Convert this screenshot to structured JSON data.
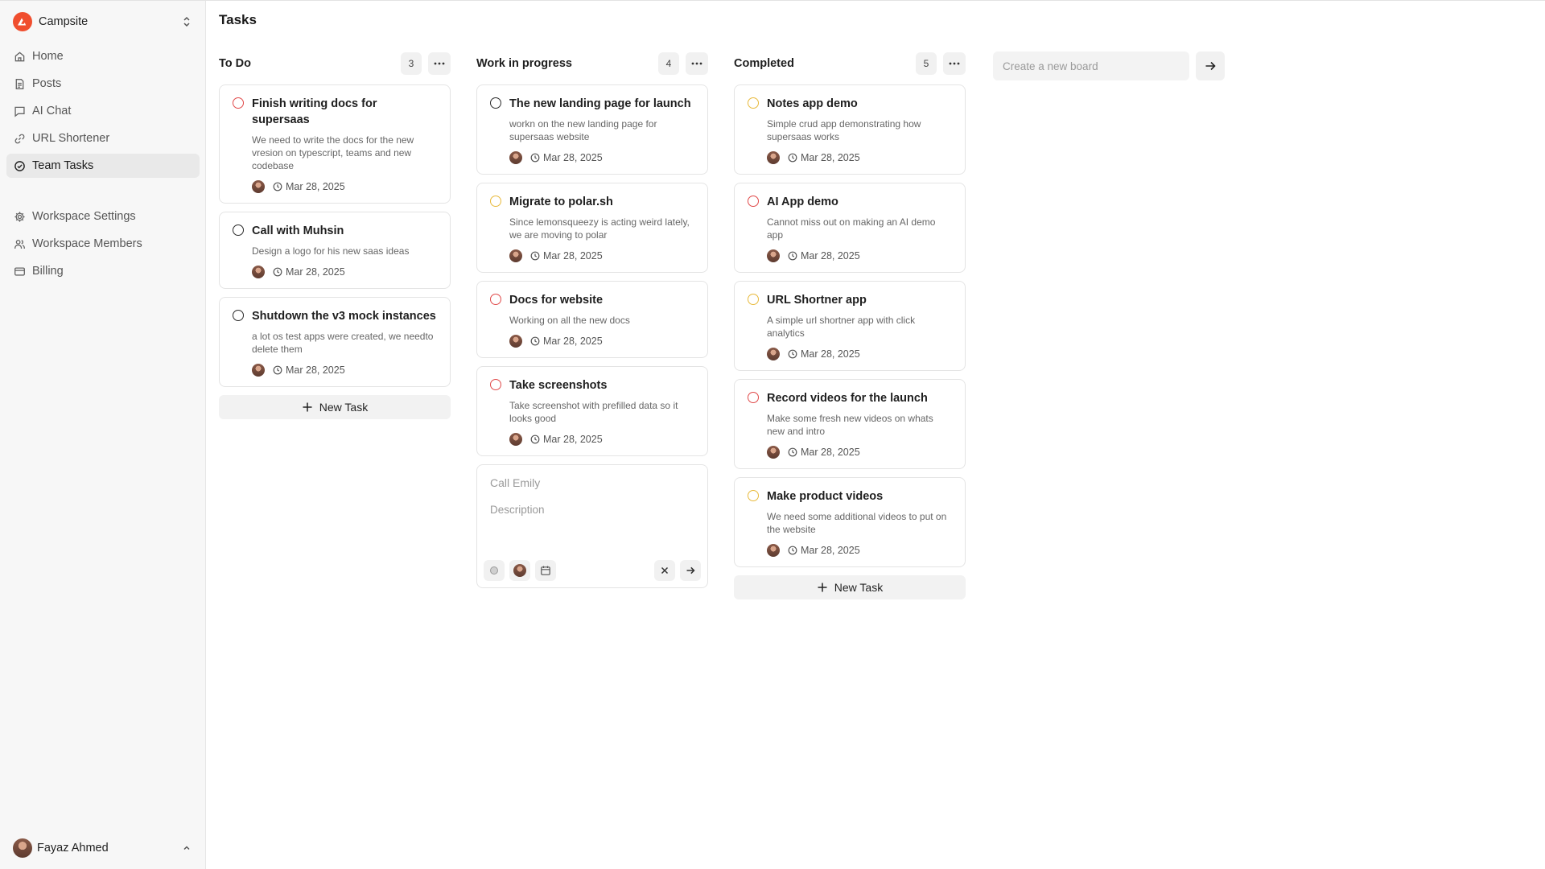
{
  "app": {
    "workspace_name": "Campsite",
    "brand_color": "#f04e2e"
  },
  "sidebar": {
    "nav": [
      {
        "label": "Home",
        "icon": "home-icon"
      },
      {
        "label": "Posts",
        "icon": "document-icon"
      },
      {
        "label": "AI Chat",
        "icon": "chat-icon"
      },
      {
        "label": "URL Shortener",
        "icon": "link-icon"
      },
      {
        "label": "Team Tasks",
        "icon": "check-circle-icon",
        "active": true
      }
    ],
    "settings": [
      {
        "label": "Workspace Settings",
        "icon": "gear-icon"
      },
      {
        "label": "Workspace Members",
        "icon": "users-icon"
      },
      {
        "label": "Billing",
        "icon": "credit-card-icon"
      }
    ],
    "user": {
      "name": "Fayaz Ahmed"
    }
  },
  "page": {
    "title": "Tasks"
  },
  "columns": [
    {
      "title": "To Do",
      "count": "3",
      "cards": [
        {
          "title": "Finish writing docs for supersaas",
          "description": "We need to write the docs for the new vresion on typescript, teams and new codebase",
          "date": "Mar 28, 2025",
          "status_color": "#e04848"
        },
        {
          "title": "Call with Muhsin",
          "description": "Design a logo for his new saas ideas",
          "date": "Mar 28, 2025",
          "status_color": "#2a2a2a"
        },
        {
          "title": "Shutdown the v3 mock instances",
          "description": "a lot os test apps were created, we needto delete them",
          "date": "Mar 28, 2025",
          "status_color": "#2a2a2a"
        }
      ],
      "new_task_label": "New Task"
    },
    {
      "title": "Work in progress",
      "count": "4",
      "cards": [
        {
          "title": "The new landing page for launch",
          "description": "workn on the new landing page for supersaas website",
          "date": "Mar 28, 2025",
          "status_color": "#2a2a2a"
        },
        {
          "title": "Migrate to polar.sh",
          "description": "Since lemonsqueezy is acting weird lately, we are moving to polar",
          "date": "Mar 28, 2025",
          "status_color": "#e8b93a"
        },
        {
          "title": "Docs for website",
          "description": "Working on all the new docs",
          "date": "Mar 28, 2025",
          "status_color": "#e04848"
        },
        {
          "title": "Take screenshots",
          "description": "Take screenshot with prefilled data so it looks good",
          "date": "Mar 28, 2025",
          "status_color": "#e04848"
        }
      ],
      "draft": {
        "title_placeholder": "Call Emily",
        "description_placeholder": "Description"
      }
    },
    {
      "title": "Completed",
      "count": "5",
      "cards": [
        {
          "title": "Notes app demo",
          "description": "Simple crud app demonstrating how supersaas works",
          "date": "Mar 28, 2025",
          "status_color": "#e8b93a"
        },
        {
          "title": "AI App demo",
          "description": "Cannot miss out on making an AI demo app",
          "date": "Mar 28, 2025",
          "status_color": "#e04848"
        },
        {
          "title": "URL Shortner app",
          "description": "A simple url shortner app with click analytics",
          "date": "Mar 28, 2025",
          "status_color": "#e8b93a"
        },
        {
          "title": "Record videos for the launch",
          "description": "Make some fresh new videos on whats new and intro",
          "date": "Mar 28, 2025",
          "status_color": "#e04848"
        },
        {
          "title": "Make product videos",
          "description": "We need some additional videos to put on the website",
          "date": "Mar 28, 2025",
          "status_color": "#e8b93a"
        }
      ],
      "new_task_label": "New Task"
    }
  ],
  "new_board": {
    "placeholder": "Create a new board"
  }
}
